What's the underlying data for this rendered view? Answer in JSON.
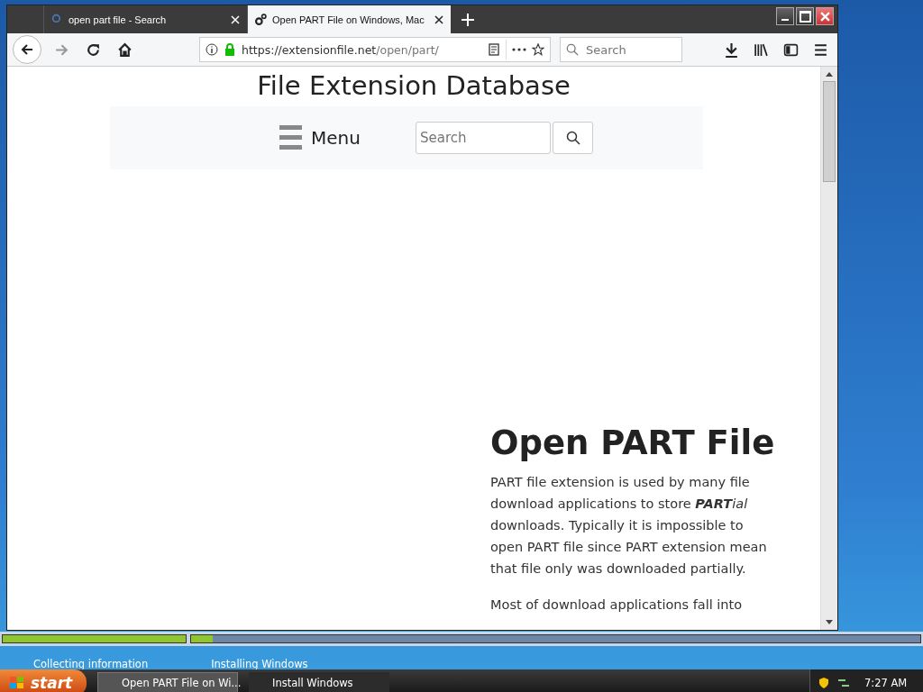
{
  "browser": {
    "tabs": [
      {
        "title": "open part file - Search",
        "selected": false
      },
      {
        "title": "Open PART File on Windows, Mac",
        "selected": true
      }
    ],
    "address": {
      "host": "https://extensionfile.net",
      "path": "/open/part/"
    },
    "search": {
      "placeholder": "Search"
    }
  },
  "page": {
    "site_title": "File Extension Database",
    "menu_label": "Menu",
    "search": {
      "placeholder": "Search"
    },
    "heading": "Open PART File",
    "intro": {
      "before": "PART file extension is used by many file download applications to store ",
      "bold": "PART",
      "italic": "ial",
      "after": " downloads. Typically it is impossible to open PART file since PART extension mean that file only was downloaded partially."
    },
    "paragraphs": [
      "Most of download applications fall into"
    ]
  },
  "setup": {
    "progress": [
      {
        "level": 1.0
      },
      {
        "level": 0.03
      }
    ],
    "steps": [
      "Collecting information",
      "Installing Windows"
    ]
  },
  "taskbar": {
    "start": "start",
    "tasks": [
      {
        "title": "Open PART File on Wi...",
        "selected": true
      },
      {
        "title": "Install Windows",
        "selected": false
      }
    ],
    "clock": "7:27 AM"
  }
}
